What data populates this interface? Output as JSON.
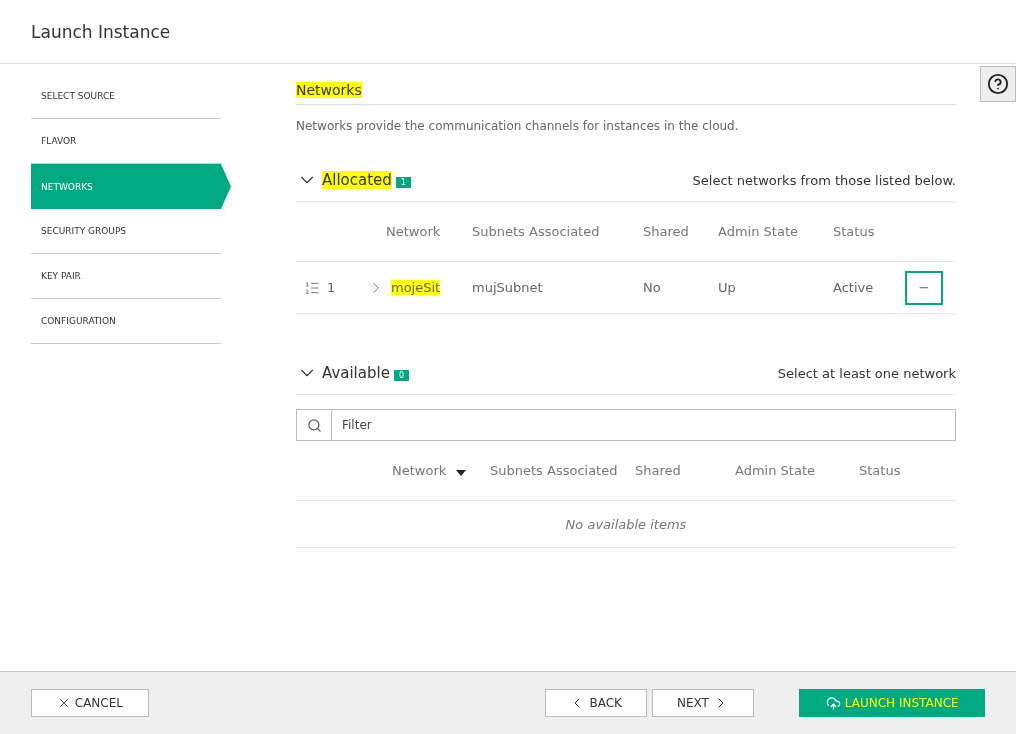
{
  "window": {
    "title": "Launch Instance"
  },
  "sidebar": {
    "items": [
      {
        "label": "SELECT SOURCE",
        "selected": false
      },
      {
        "label": "FLAVOR",
        "selected": false
      },
      {
        "label": "NETWORKS",
        "selected": true
      },
      {
        "label": "SECURITY GROUPS",
        "selected": false
      },
      {
        "label": "KEY PAIR",
        "selected": false
      },
      {
        "label": "CONFIGURATION",
        "selected": false
      }
    ]
  },
  "section": {
    "title": "Networks",
    "highlighted": true,
    "description": "Networks provide the communication channels for instances in the cloud."
  },
  "allocated": {
    "title": "Allocated",
    "highlighted": true,
    "expanded": true,
    "count": "1",
    "hint": "Select networks from those listed below.",
    "columns": [
      "Network",
      "Subnets Associated",
      "Shared",
      "Admin State",
      "Status"
    ],
    "rows": [
      {
        "index": "1",
        "network": "mojeSit",
        "network_highlighted": true,
        "subnets": "mujSubnet",
        "shared": "No",
        "admin_state": "Up",
        "status": "Active",
        "action": "−"
      }
    ]
  },
  "available": {
    "title": "Available",
    "highlighted": false,
    "expanded": true,
    "count": "0",
    "hint": "Select at least one network",
    "filter": {
      "placeholder": "Filter"
    },
    "columns": [
      "Network",
      "Subnets Associated",
      "Shared",
      "Admin State",
      "Status"
    ],
    "empty": "No available items"
  },
  "footer": {
    "cancel": "CANCEL",
    "back": "BACK",
    "next": "NEXT",
    "launch": {
      "label": "LAUNCH INSTANCE",
      "highlighted": true
    }
  }
}
